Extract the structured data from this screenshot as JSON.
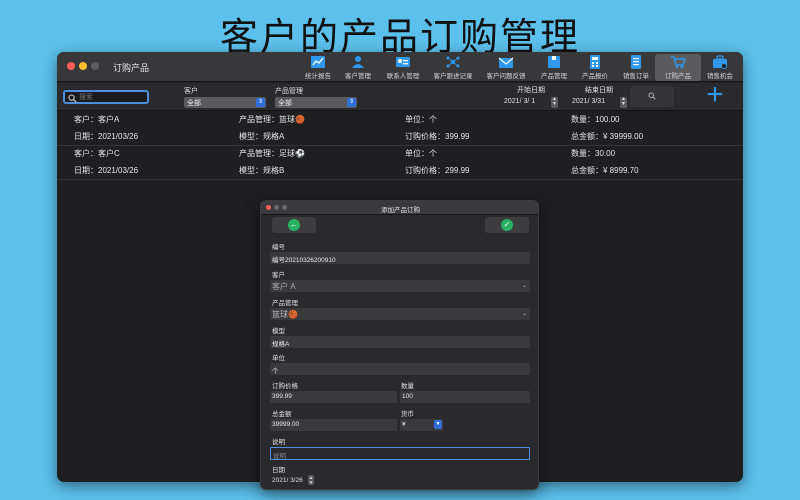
{
  "headline": "客户的产品订购管理",
  "window": {
    "title": "订购产品"
  },
  "toolbar": [
    {
      "id": "stats",
      "icon": "chart-icon",
      "label": "统计报告"
    },
    {
      "id": "customers",
      "icon": "people-icon",
      "label": "客户管理"
    },
    {
      "id": "contacts",
      "icon": "contact-card-icon",
      "label": "联系人管理"
    },
    {
      "id": "followup",
      "icon": "network-icon",
      "label": "客户跟进记录"
    },
    {
      "id": "feedback",
      "icon": "mail-icon",
      "label": "客户问题反馈"
    },
    {
      "id": "products",
      "icon": "box-icon",
      "label": "产品管理"
    },
    {
      "id": "quotes",
      "icon": "calculator-icon",
      "label": "产品报价"
    },
    {
      "id": "salesorders",
      "icon": "document-icon",
      "label": "销售订单"
    },
    {
      "id": "orderproducts",
      "icon": "cart-icon",
      "label": "订购产品",
      "active": true
    },
    {
      "id": "opportunities",
      "icon": "briefcase-icon",
      "label": "销售机会"
    }
  ],
  "filters": {
    "search_placeholder": "搜索",
    "customer_label": "客户",
    "customer_value": "全部",
    "product_label": "产品管理",
    "product_value": "全部",
    "start_label": "开始日期",
    "start_value": "2021/ 3/ 1",
    "end_label": "结束日期",
    "end_value": "2021/ 3/31",
    "add_symbol": "+"
  },
  "orders": [
    {
      "customer": "客户：客户A",
      "date": "日期：2021/03/26",
      "product": "产品管理：篮球🏀",
      "model": "模型：规格A",
      "unit": "单位：个",
      "price": "订购价格：399.99",
      "quantity": "数量：100.00",
      "total": "总金额：¥ 39999.00"
    },
    {
      "customer": "客户：客户C",
      "date": "日期：2021/03/26",
      "product": "产品管理：足球⚽",
      "model": "模型：规格B",
      "unit": "单位：个",
      "price": "订购价格：299.99",
      "quantity": "数量：30.00",
      "total": "总金额：¥ 8999.70"
    }
  ],
  "dialog": {
    "title": "添加产品订购",
    "back_symbol": "←",
    "confirm_symbol": "✓",
    "number_label": "编号",
    "number_value": "编号20210326200910",
    "customer_label": "客户",
    "customer_value": "客户 A",
    "product_label": "产品管理",
    "product_value": "篮球🏀",
    "model_label": "模型",
    "model_value": "规格A",
    "unit_label": "单位",
    "unit_value": "个",
    "price_label": "订购价格",
    "price_value": "399.99",
    "quantity_label": "数量",
    "quantity_value": "100",
    "total_label": "总金额",
    "total_value": "39999.00",
    "currency_label": "货币",
    "currency_value": "¥",
    "note_label": "说明",
    "note_placeholder": "说明",
    "date_label": "日期",
    "date_value": "2021/ 3/26"
  }
}
